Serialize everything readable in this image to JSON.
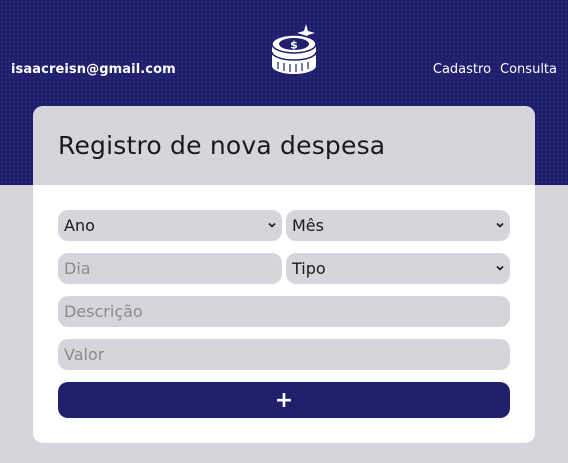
{
  "header": {
    "user_email": "isaacreisn@gmail.com",
    "logo_icon": "coin-stack-dollar-icon",
    "nav": [
      {
        "label": "Cadastro"
      },
      {
        "label": "Consulta"
      }
    ]
  },
  "card": {
    "title": "Registro de nova despesa"
  },
  "form": {
    "ano": {
      "selected": "Ano"
    },
    "mes": {
      "selected": "Mês"
    },
    "dia": {
      "placeholder": "Dia"
    },
    "tipo": {
      "selected": "Tipo"
    },
    "descricao": {
      "placeholder": "Descrição"
    },
    "valor": {
      "placeholder": "Valor"
    },
    "add_button_label": "+"
  },
  "colors": {
    "primary": "#1f1f6e",
    "field_bg": "#d6d5db",
    "card_bg": "#ffffff"
  }
}
